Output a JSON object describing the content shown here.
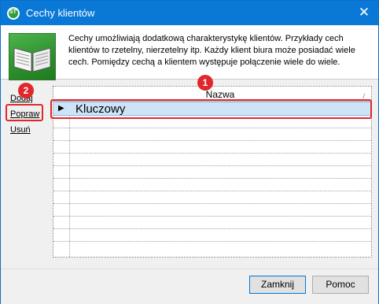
{
  "window": {
    "title": "Cechy klientów"
  },
  "header": {
    "description": "Cechy umożliwiają dodatkową charakterystykę klientów. Przykłady cech klientów to rzetelny, nierzetelny itp. Każdy klient biura może posiadać wiele cech. Pomiędzy cechą a klientem występuje połączenie wiele do wiele."
  },
  "actions": [
    {
      "label": "Dodaj"
    },
    {
      "label": "Popraw"
    },
    {
      "label": "Usuń"
    }
  ],
  "grid": {
    "column": "Nazwa",
    "sort_indicator": "/",
    "rows": [
      {
        "name": "Kluczowy",
        "selected": true
      }
    ]
  },
  "annotations": [
    {
      "label": "1"
    },
    {
      "label": "2"
    }
  ],
  "footer": {
    "close_label": "Zamknij",
    "help_label": "Pomoc"
  },
  "colors": {
    "titlebar": "#0a78d7",
    "highlight": "#e0282c",
    "selection": "#cde4f8"
  }
}
